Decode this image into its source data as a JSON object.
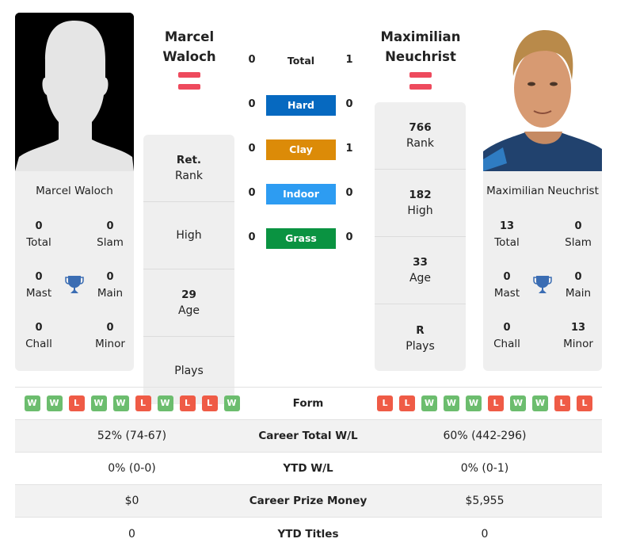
{
  "colors": {
    "hard": "#0669c0",
    "clay": "#dc8b08",
    "indoor": "#2d9cf2",
    "grass": "#0a9341",
    "win": "#6cbd6e",
    "loss": "#ef5b46",
    "flag_red": "#ee4a5d",
    "trophy": "#3b6db3"
  },
  "player1": {
    "name_line1": "Marcel",
    "name_line2": "Waloch",
    "full_name": "Marcel Waloch",
    "flag": "austria-flag",
    "titles": {
      "total": {
        "value": "0",
        "label": "Total"
      },
      "slam": {
        "value": "0",
        "label": "Slam"
      },
      "mast": {
        "value": "0",
        "label": "Mast"
      },
      "main": {
        "value": "0",
        "label": "Main"
      },
      "chall": {
        "value": "0",
        "label": "Chall"
      },
      "minor": {
        "value": "0",
        "label": "Minor"
      }
    },
    "info": {
      "rank": {
        "value": "Ret.",
        "label": "Rank"
      },
      "high": {
        "value": "",
        "label": "High"
      },
      "age": {
        "value": "29",
        "label": "Age"
      },
      "plays": {
        "value": "",
        "label": "Plays"
      }
    },
    "form": [
      "W",
      "W",
      "L",
      "W",
      "W",
      "L",
      "W",
      "L",
      "L",
      "W"
    ],
    "career_wl": "52% (74-67)",
    "ytd_wl": "0% (0-0)",
    "prize": "$0",
    "ytd_titles": "0"
  },
  "player2": {
    "name_line1": "Maximilian",
    "name_line2": "Neuchrist",
    "full_name": "Maximilian Neuchrist",
    "flag": "austria-flag",
    "titles": {
      "total": {
        "value": "13",
        "label": "Total"
      },
      "slam": {
        "value": "0",
        "label": "Slam"
      },
      "mast": {
        "value": "0",
        "label": "Mast"
      },
      "main": {
        "value": "0",
        "label": "Main"
      },
      "chall": {
        "value": "0",
        "label": "Chall"
      },
      "minor": {
        "value": "13",
        "label": "Minor"
      }
    },
    "info": {
      "rank": {
        "value": "766",
        "label": "Rank"
      },
      "high": {
        "value": "182",
        "label": "High"
      },
      "age": {
        "value": "33",
        "label": "Age"
      },
      "plays": {
        "value": "R",
        "label": "Plays"
      }
    },
    "form": [
      "L",
      "L",
      "W",
      "W",
      "W",
      "L",
      "W",
      "W",
      "L",
      "L"
    ],
    "career_wl": "60% (442-296)",
    "ytd_wl": "0% (0-1)",
    "prize": "$5,955",
    "ytd_titles": "0"
  },
  "h2h": [
    {
      "label": "Total",
      "p1": "0",
      "p2": "1",
      "surface": "total"
    },
    {
      "label": "Hard",
      "p1": "0",
      "p2": "0",
      "surface": "hard"
    },
    {
      "label": "Clay",
      "p1": "0",
      "p2": "1",
      "surface": "clay"
    },
    {
      "label": "Indoor",
      "p1": "0",
      "p2": "0",
      "surface": "indoor"
    },
    {
      "label": "Grass",
      "p1": "0",
      "p2": "0",
      "surface": "grass"
    }
  ],
  "table": {
    "form_label": "Form",
    "career_wl_label": "Career Total W/L",
    "ytd_wl_label": "YTD W/L",
    "prize_label": "Career Prize Money",
    "ytd_titles_label": "YTD Titles"
  }
}
